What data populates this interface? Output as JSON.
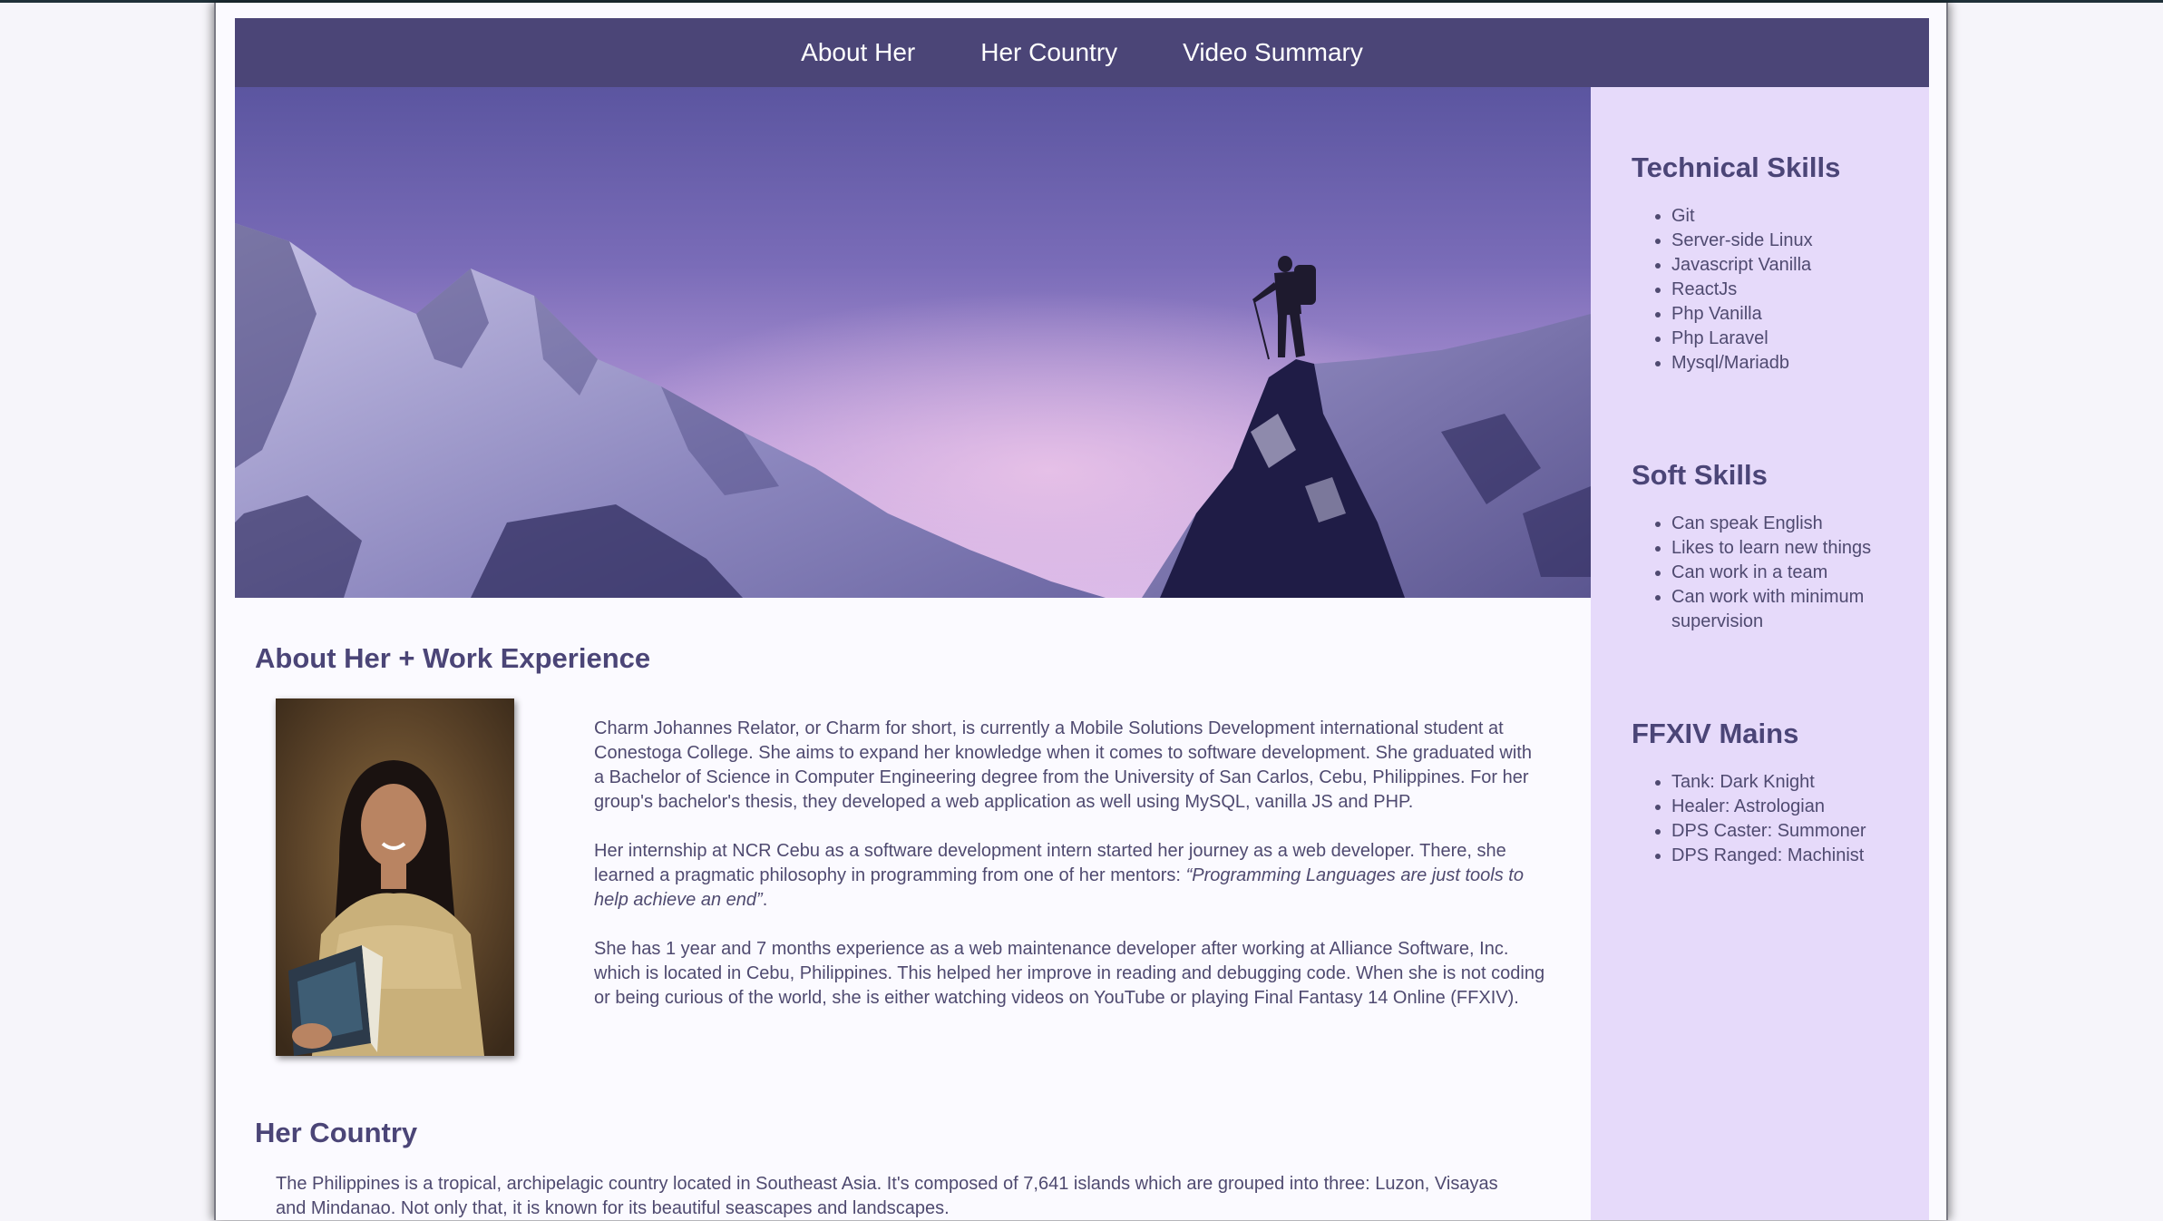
{
  "nav": {
    "items": [
      "About Her",
      "Her Country",
      "Video Summary"
    ]
  },
  "sidebar": {
    "technical": {
      "title": "Technical Skills",
      "items": [
        "Git",
        "Server-side Linux",
        "Javascript Vanilla",
        "ReactJs",
        "Php Vanilla",
        "Php Laravel",
        "Mysql/Mariadb"
      ]
    },
    "soft": {
      "title": "Soft Skills",
      "items": [
        "Can speak English",
        "Likes to learn new things",
        "Can work in a team",
        "Can work with minimum supervision"
      ]
    },
    "ffxiv": {
      "title": "FFXIV Mains",
      "items": [
        "Tank: Dark Knight",
        "Healer: Astrologian",
        "DPS Caster: Summoner",
        "DPS Ranged: Machinist"
      ]
    }
  },
  "about": {
    "title": "About Her + Work Experience",
    "p1": "Charm Johannes Relator, or Charm for short, is currently a Mobile Solutions Development international student at Conestoga College. She aims to expand her knowledge when it comes to software development. She graduated with a Bachelor of Science in Computer Engineering degree from the University of San Carlos, Cebu, Philippines. For her group's bachelor's thesis, they developed a web application as well using MySQL, vanilla JS and PHP.",
    "p2_lead": "Her internship at NCR Cebu as a software development intern started her journey as a web developer. There, she learned a pragmatic philosophy in programming from one of her mentors: ",
    "p2_quote": "“Programming Languages are just tools to help achieve an end”",
    "p2_tail": ".",
    "p3": "She has 1 year and 7 months experience as a web maintenance developer after working at Alliance Software, Inc. which is located in Cebu, Philippines. This helped her improve in reading and debugging code. When she is not coding or being curious of the world, she is either watching videos on YouTube or playing Final Fantasy 14 Online (FFXIV)."
  },
  "country": {
    "title": "Her Country",
    "text": "The Philippines is a tropical, archipelagic country located in Southeast Asia. It's composed of 7,641 islands which are grouped into three: Luzon, Visayas and Mindanao. Not only that, it is known for its beautiful seascapes and landscapes."
  },
  "colors": {
    "nav_bg": "#4b4577",
    "sidebar_bg": "#e6dafa",
    "heading": "#4b4577",
    "body_text": "#4f4a70"
  }
}
